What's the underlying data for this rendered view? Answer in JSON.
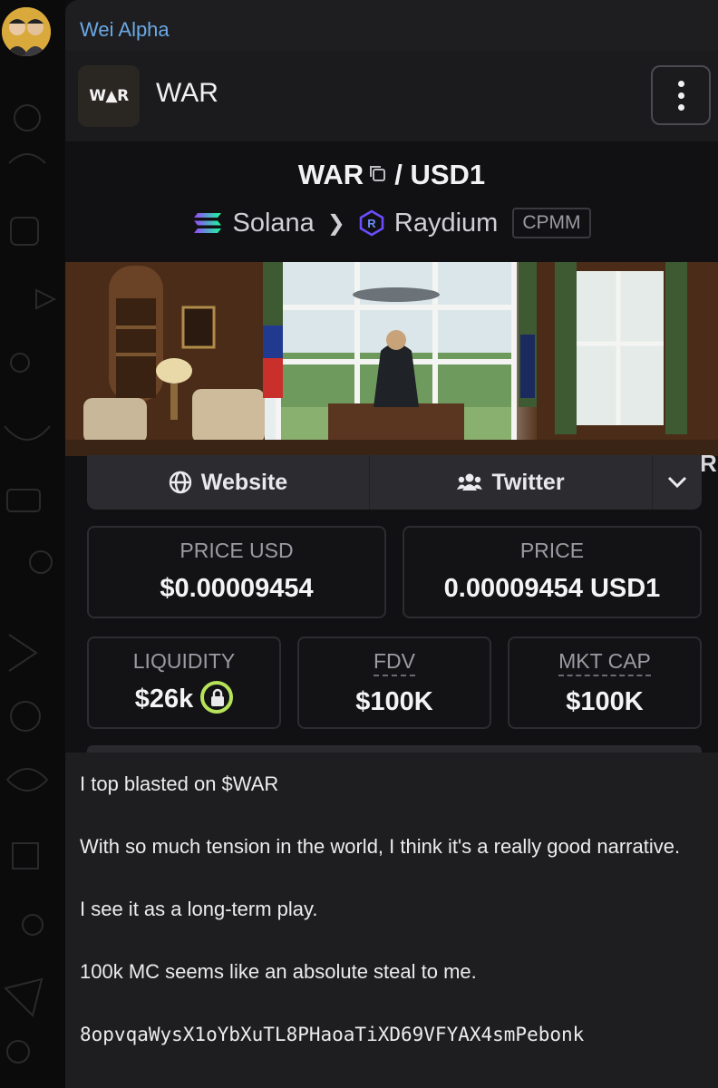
{
  "message": {
    "sender": "Wei Alpha",
    "paragraphs": [
      "I top blasted on $WAR",
      "With so much tension in the world, I think it's a really good narrative.",
      "I see it as a long-term play.",
      "100k MC seems like an absolute steal to me."
    ],
    "contract_address": "8opvqaWysX1oYbXuTL8PHaoaTiXD69VFYAX4smPebonk"
  },
  "card": {
    "token_logo_text": "W▲R",
    "token_name": "WAR",
    "pair_base": "WAR",
    "pair_separator": "/",
    "pair_quote": "USD1",
    "chain": "Solana",
    "dex": "Raydium",
    "pool_type": "CPMM",
    "banner_watermark": "R",
    "links": {
      "website": "Website",
      "twitter": "Twitter"
    },
    "stats": {
      "price_usd_label": "PRICE USD",
      "price_usd_value": "$0.00009454",
      "price_label": "PRICE",
      "price_value": "0.00009454 USD1",
      "liquidity_label": "LIQUIDITY",
      "liquidity_value": "$26k",
      "fdv_label": "FDV",
      "fdv_value": "$100K",
      "mktcap_label": "MKT CAP",
      "mktcap_value": "$100K"
    }
  },
  "colors": {
    "sender_name": "#6aa9e6",
    "liquidity_lock": "#b7e35a",
    "bubble_bg": "#1e1e20"
  }
}
